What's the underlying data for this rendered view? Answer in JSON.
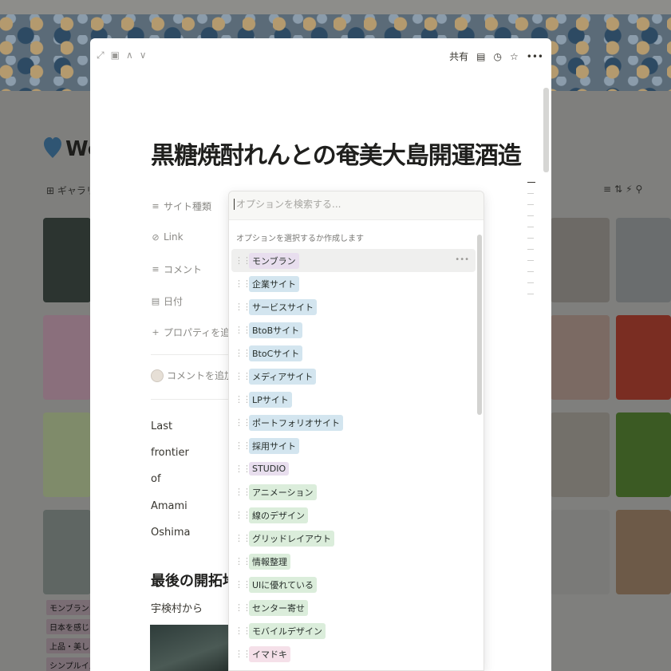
{
  "background": {
    "page_title": "Wel",
    "view_label": "ギャラリー",
    "tags": [
      "モンブラン",
      "日本を感じる",
      "上品・美しい",
      "シンプルイズベ"
    ]
  },
  "modal": {
    "toolbar": {
      "share_label": "共有",
      "comment_icon": "comment-icon",
      "updates_icon": "clock-icon",
      "favorite_icon": "star-icon",
      "more_label": "•••"
    },
    "title": "黒糖焼酎れんとの奄美大島開運酒造",
    "properties": [
      {
        "icon": "≡",
        "label": "サイト種類"
      },
      {
        "icon": "⊘",
        "label": "Link"
      },
      {
        "icon": "≡",
        "label": "コメント"
      },
      {
        "icon": "▤",
        "label": "日付"
      },
      {
        "icon": "+",
        "label": "プロパティを追加する"
      }
    ],
    "comment_placeholder": "コメントを追加...",
    "body_lines": [
      "Last",
      "frontier",
      "of",
      "Amami",
      "Oshima"
    ],
    "heading": "最後の開拓地奄",
    "subtext": "宇検村から"
  },
  "dropdown": {
    "search_placeholder": "オプションを検索する...",
    "hint": "オプションを選択するか作成します",
    "more_label": "•••",
    "options": [
      {
        "label": "モンブラン",
        "color": "#e8deee"
      },
      {
        "label": "企業サイト",
        "color": "#d3e5ef"
      },
      {
        "label": "サービスサイト",
        "color": "#d3e5ef"
      },
      {
        "label": "BtoBサイト",
        "color": "#d3e5ef"
      },
      {
        "label": "BtoCサイト",
        "color": "#d3e5ef"
      },
      {
        "label": "メディアサイト",
        "color": "#d3e5ef"
      },
      {
        "label": "LPサイト",
        "color": "#d3e5ef"
      },
      {
        "label": "ポートフォリオサイト",
        "color": "#d3e5ef"
      },
      {
        "label": "採用サイト",
        "color": "#d3e5ef"
      },
      {
        "label": "STUDIO",
        "color": "#e8deee"
      },
      {
        "label": "アニメーション",
        "color": "#dbeddb"
      },
      {
        "label": "線のデザイン",
        "color": "#dbeddb"
      },
      {
        "label": "グリッドレイアウト",
        "color": "#dbeddb"
      },
      {
        "label": "情報整理",
        "color": "#dbeddb"
      },
      {
        "label": "UIに優れている",
        "color": "#dbeddb"
      },
      {
        "label": "センター寄せ",
        "color": "#dbeddb"
      },
      {
        "label": "モバイルデザイン",
        "color": "#dbeddb"
      },
      {
        "label": "イマドキ",
        "color": "#f5e0e9"
      }
    ]
  }
}
